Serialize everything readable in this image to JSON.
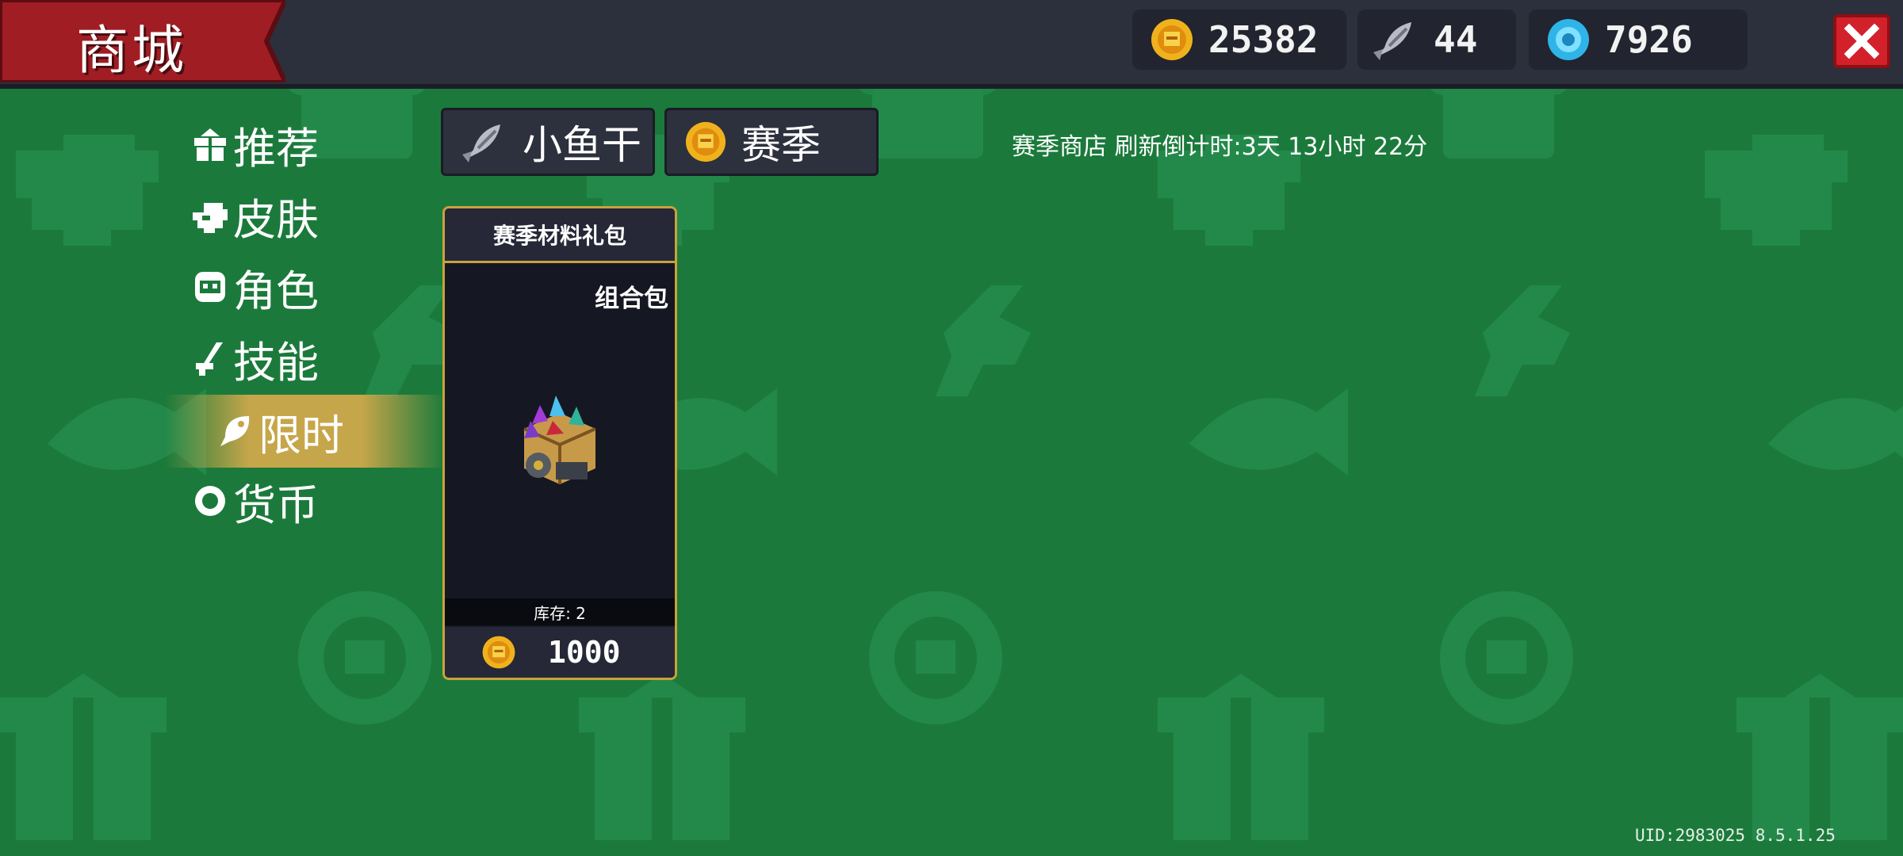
{
  "header": {
    "title": "商城",
    "gold": "25382",
    "fish": "44",
    "gems": "7926"
  },
  "sidebar": {
    "items": [
      {
        "label": "推荐",
        "icon": "gift-icon"
      },
      {
        "label": "皮肤",
        "icon": "helmet-icon"
      },
      {
        "label": "角色",
        "icon": "character-icon"
      },
      {
        "label": "技能",
        "icon": "skill-icon"
      },
      {
        "label": "限时",
        "icon": "fish-icon",
        "active": true
      },
      {
        "label": "货币",
        "icon": "coin-icon"
      }
    ]
  },
  "tabs": [
    {
      "label": "小鱼干",
      "icon": "dried-fish-icon"
    },
    {
      "label": "赛季",
      "icon": "gold-coin-icon"
    }
  ],
  "countdown": "赛季商店 刷新倒计时:3天 13小时 22分",
  "card": {
    "title": "赛季材料礼包",
    "tag": "组合包",
    "stock": "库存: 2",
    "price": "1000"
  },
  "footer": {
    "uid": "UID:2983025 8.5.1.25"
  },
  "colors": {
    "background": "#1b7a3b",
    "pattern": "#23894a",
    "topbar": "#2c2f3c",
    "banner": "#a01d24",
    "close": "#d3212b",
    "card_border": "#c9a23c",
    "active_highlight": "#c6a64a"
  }
}
